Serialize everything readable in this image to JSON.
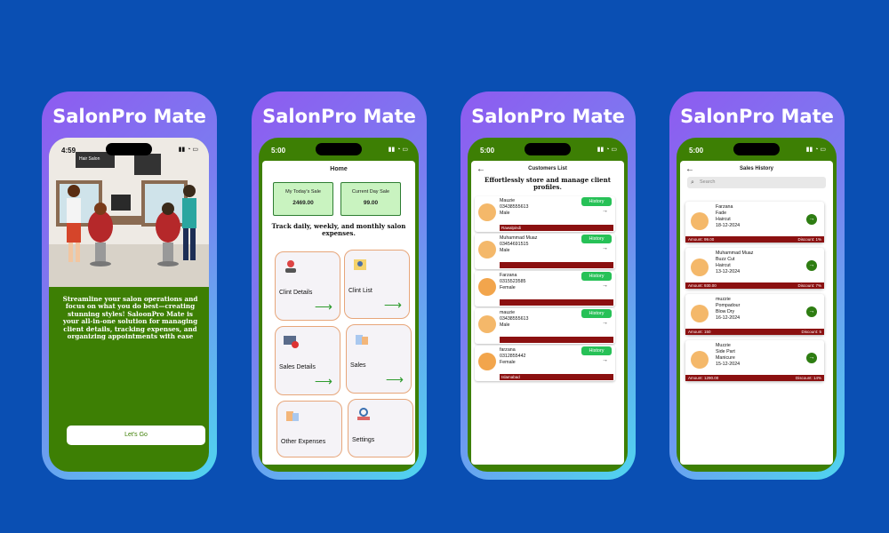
{
  "app_name": "SalonPro Mate",
  "colors": {
    "background": "#0a4fb3",
    "phone_green": "#3d7f04",
    "history_green": "#27c157",
    "dark_red": "#8b1010"
  },
  "screen1": {
    "time": "4:59",
    "shop_sign": "Hair Salon",
    "description": "Streamline your salon operations and focus on what you do best—creating stunning styles! SaloonPro Mate is your all-in-one solution for managing client details, tracking expenses, and organizing appointments with ease",
    "button": "Let's Go"
  },
  "screen2": {
    "time": "5:00",
    "title": "Home",
    "today_sale_label": "My Today's Sale",
    "today_sale_value": "2469.00",
    "current_sale_label": "Current Day Sale",
    "current_sale_value": "99.00",
    "tagline": "Track daily, weekly, and monthly salon expenses.",
    "tiles": [
      {
        "label": "Clint Details",
        "icon": "client-details-icon"
      },
      {
        "label": "Clint List",
        "icon": "client-list-icon"
      },
      {
        "label": "Sales Details",
        "icon": "sales-details-icon"
      },
      {
        "label": "Sales",
        "icon": "sales-icon"
      },
      {
        "label": "Other Expenses",
        "icon": "expenses-icon"
      },
      {
        "label": "Settings",
        "icon": "settings-icon"
      }
    ]
  },
  "screen3": {
    "time": "5:00",
    "title": "Customers List",
    "subtitle": "Effortlessly store and manage client profiles.",
    "history_label": "History",
    "customers": [
      {
        "name": "Mauzie",
        "phone": "03438555613",
        "gender": "Male",
        "city": "Rawalpindi"
      },
      {
        "name": "Muhammad Muaz",
        "phone": "03454691515",
        "gender": "Male",
        "city": ""
      },
      {
        "name": "Farzana",
        "phone": "0315523585",
        "gender": "Female",
        "city": ""
      },
      {
        "name": "mauzie",
        "phone": "03438555613",
        "gender": "Male",
        "city": ""
      },
      {
        "name": "farzana",
        "phone": "0312855442",
        "gender": "Female",
        "city": "Islamabad"
      }
    ]
  },
  "screen4": {
    "time": "5:00",
    "title": "Sales History",
    "search_placeholder": "Search",
    "sales": [
      {
        "name": "Farzana",
        "s1": "Fade",
        "s2": "Haircut",
        "date": "18-12-2024",
        "amount": "Amount: 99.00",
        "discount": "Discount: 1%"
      },
      {
        "name": "Muhammad Muaz",
        "s1": "Buzz Cut",
        "s2": "Haircut",
        "date": "13-12-2024",
        "amount": "Amount: 930.00",
        "discount": "Discount: 7%"
      },
      {
        "name": "muzzie",
        "s1": "Pompadour",
        "s2": "Blow Dry",
        "date": "16-12-2024",
        "amount": "Amount: 150",
        "discount": "Discount: 5"
      },
      {
        "name": "Muzzie",
        "s1": "Side Part",
        "s2": "Manicure",
        "date": "15-12-2024",
        "amount": "Amount: 1290.00",
        "discount": "Discount: 14%"
      }
    ]
  }
}
